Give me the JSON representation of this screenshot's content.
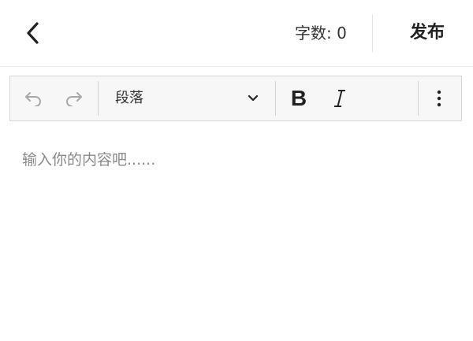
{
  "header": {
    "word_count_label": "字数: 0",
    "publish_label": "发布"
  },
  "toolbar": {
    "paragraph_select": "段落",
    "icons": [
      "undo-icon",
      "redo-icon",
      "chevron-down-icon",
      "bold-icon",
      "italic-icon",
      "more-vertical-icon"
    ]
  },
  "editor": {
    "placeholder": "输入你的内容吧......"
  },
  "colors": {
    "icon_active": "#222222",
    "icon_disabled": "#a8a8a8",
    "toolbar_bg": "#f7f7f7",
    "placeholder": "#8a8a8a"
  }
}
